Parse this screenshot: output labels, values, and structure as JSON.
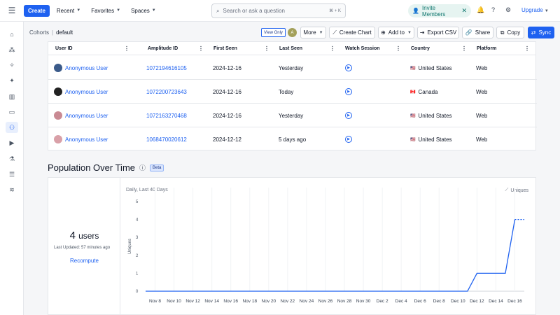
{
  "topbar": {
    "create_label": "Create",
    "menus": [
      "Recent",
      "Favorites",
      "Spaces"
    ],
    "search_placeholder": "Search or ask a question",
    "search_shortcut": "⌘ + K",
    "invite_label": "Invite Members",
    "upgrade_label": "Upgrade"
  },
  "breadcrumb": {
    "parent": "Cohorts",
    "current": "default"
  },
  "toolbar": {
    "view_only": "View Only",
    "avatar_initial": "A",
    "more": "More",
    "create_chart": "Create Chart",
    "add_to": "Add to",
    "export_csv": "Export CSV",
    "share": "Share",
    "copy": "Copy",
    "sync": "Sync"
  },
  "table": {
    "columns": [
      "User ID",
      "Amplitude ID",
      "First Seen",
      "Last Seen",
      "Watch Session",
      "Country",
      "Platform"
    ],
    "rows": [
      {
        "user": "Anonymous User",
        "amp_id": "1072194616105",
        "first_seen": "2024-12-16",
        "last_seen": "Yesterday",
        "country": "United States",
        "flag": "🇺🇸",
        "platform": "Web",
        "avatar_color": "#3b5b8a"
      },
      {
        "user": "Anonymous User",
        "amp_id": "1072200723643",
        "first_seen": "2024-12-16",
        "last_seen": "Today",
        "country": "Canada",
        "flag": "🇨🇦",
        "platform": "Web",
        "avatar_color": "#222222"
      },
      {
        "user": "Anonymous User",
        "amp_id": "1072163270468",
        "first_seen": "2024-12-16",
        "last_seen": "Yesterday",
        "country": "United States",
        "flag": "🇺🇸",
        "platform": "Web",
        "avatar_color": "#c98a93"
      },
      {
        "user": "Anonymous User",
        "amp_id": "1068470020612",
        "first_seen": "2024-12-12",
        "last_seen": "5 days ago",
        "country": "United States",
        "flag": "🇺🇸",
        "platform": "Web",
        "avatar_color": "#d9a0a8"
      }
    ]
  },
  "population": {
    "title": "Population Over Time",
    "beta": "Beta",
    "count": "4",
    "count_word": "users",
    "last_updated": "Last Updated: 57 minutes ago",
    "recompute": "Recompute",
    "subtitle": "Daily, Last 40 Days",
    "legend": "Uniques"
  },
  "chart_data": {
    "type": "line",
    "title": "",
    "xlabel": "",
    "ylabel": "Uniques",
    "ylim": [
      0,
      5
    ],
    "yticks": [
      0,
      1,
      2,
      3,
      4,
      5
    ],
    "xtick_labels": [
      "Nov 8",
      "Nov 10",
      "Nov 12",
      "Nov 14",
      "Nov 16",
      "Nov 18",
      "Nov 20",
      "Nov 22",
      "Nov 24",
      "Nov 26",
      "Nov 28",
      "Nov 30",
      "Dec 2",
      "Dec 4",
      "Dec 6",
      "Dec 8",
      "Dec 10",
      "Dec 12",
      "Dec 14",
      "Dec 16"
    ],
    "series": [
      {
        "name": "Uniques",
        "color": "#1e61f0",
        "values": [
          0,
          0,
          0,
          0,
          0,
          0,
          0,
          0,
          0,
          0,
          0,
          0,
          0,
          0,
          0,
          0,
          0,
          0,
          0,
          0,
          0,
          0,
          0,
          0,
          0,
          0,
          0,
          0,
          0,
          0,
          0,
          0,
          0,
          0,
          0,
          1,
          1,
          1,
          1,
          4,
          4
        ]
      }
    ],
    "incomplete_last_point": true,
    "grid": "vertical-light"
  }
}
